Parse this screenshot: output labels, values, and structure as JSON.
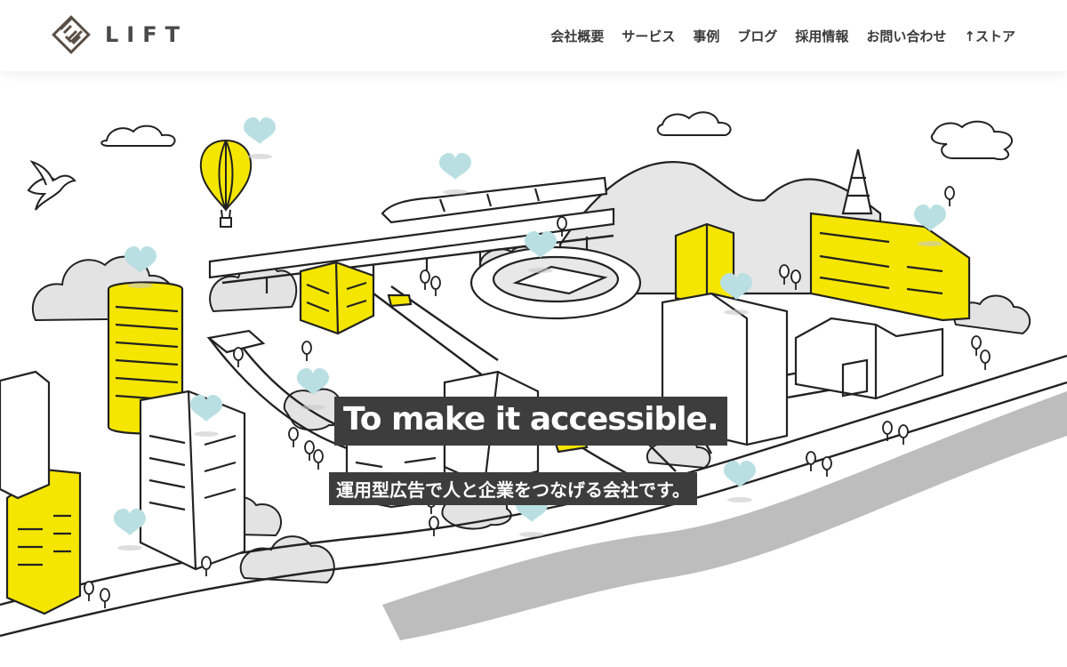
{
  "brand": {
    "name": "LIFT"
  },
  "nav": {
    "items": [
      {
        "label": "会社概要"
      },
      {
        "label": "サービス"
      },
      {
        "label": "事例"
      },
      {
        "label": "ブログ"
      },
      {
        "label": "採用情報"
      },
      {
        "label": "お問い合わせ"
      },
      {
        "label": "↑ストア"
      }
    ]
  },
  "hero": {
    "title": "To make it accessible.",
    "subtitle": "運用型広告で人と企業をつなげる会社です。"
  },
  "colors": {
    "accent_yellow": "#f5e600",
    "heart_blue": "#b9dfe2",
    "ink": "#222222",
    "tree_gray": "#e3e3e3",
    "caption_bg": "#3d3d3d"
  },
  "icons": [
    "logo-mark-icon",
    "heart-icon",
    "bird-icon",
    "hot-air-balloon-icon"
  ]
}
